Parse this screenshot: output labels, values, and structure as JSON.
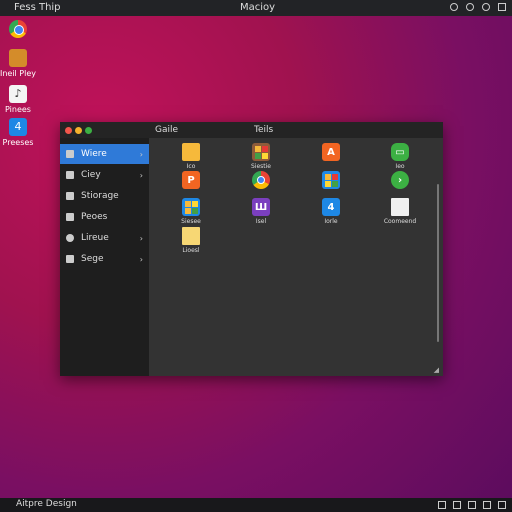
{
  "topbar": {
    "left": "Fess Thip",
    "center": "Macioy",
    "tray_icons": [
      "location-icon",
      "record-icon",
      "settings-icon",
      "window-icon"
    ]
  },
  "desktop_icons": [
    {
      "label": "",
      "icon": "chrome-icon"
    },
    {
      "label": "Ineil Pley",
      "icon": "app-icon"
    },
    {
      "label": "Pinees",
      "icon": "music-icon"
    },
    {
      "label": "Preeses",
      "icon": "blue-app-icon"
    }
  ],
  "window": {
    "title_left": "Gaile",
    "title_right": "Teils",
    "sidebar": [
      {
        "label": "Wiere",
        "icon": "wand-icon",
        "active": true,
        "chevron": true
      },
      {
        "label": "Ciey",
        "icon": "doc-icon",
        "active": false,
        "chevron": true
      },
      {
        "label": "Stiorage",
        "icon": "gear-icon",
        "active": false,
        "chevron": false
      },
      {
        "label": "Peoes",
        "icon": "folder-icon",
        "active": false,
        "chevron": false
      },
      {
        "label": "Lireue",
        "icon": "clock-icon",
        "active": false,
        "chevron": true
      },
      {
        "label": "Sege",
        "icon": "list-icon",
        "active": false,
        "chevron": true
      }
    ],
    "apps": [
      {
        "label": "Ico",
        "icon": "folder-icon",
        "color": "#f6b93b"
      },
      {
        "label": "Siestie",
        "icon": "grid-app-icon",
        "color": "#8e5b3a"
      },
      {
        "label": "",
        "icon": "a-app-icon",
        "color": "#f26522"
      },
      {
        "label": "Ieo",
        "icon": "green-app-icon",
        "color": "#3cb043"
      },
      {
        "label": "",
        "icon": "p-app-icon",
        "color": "#f26522"
      },
      {
        "label": "",
        "icon": "chrome-icon",
        "color": "#ffffff"
      },
      {
        "label": "",
        "icon": "colored-grid-icon",
        "color": "#1e88e5"
      },
      {
        "label": "",
        "icon": "green-circle-icon",
        "color": "#3cb043"
      },
      {
        "label": "Siesee",
        "icon": "mosaic-icon",
        "color": "#f6b93b"
      },
      {
        "label": "Isel",
        "icon": "purple-app-icon",
        "color": "#7b3fbf"
      },
      {
        "label": "Iorle",
        "icon": "blue-app-icon",
        "color": "#1e88e5"
      },
      {
        "label": "Coomeend",
        "icon": "file-icon",
        "color": "#f0f0f0"
      },
      {
        "label": "Lioesl",
        "icon": "note-icon",
        "color": "#f7d774"
      }
    ]
  },
  "bottombar": {
    "left": "Aitpre Design",
    "tray_icons": [
      "network-icon",
      "wifi-icon",
      "volume-icon",
      "battery-icon",
      "clock-icon"
    ]
  }
}
